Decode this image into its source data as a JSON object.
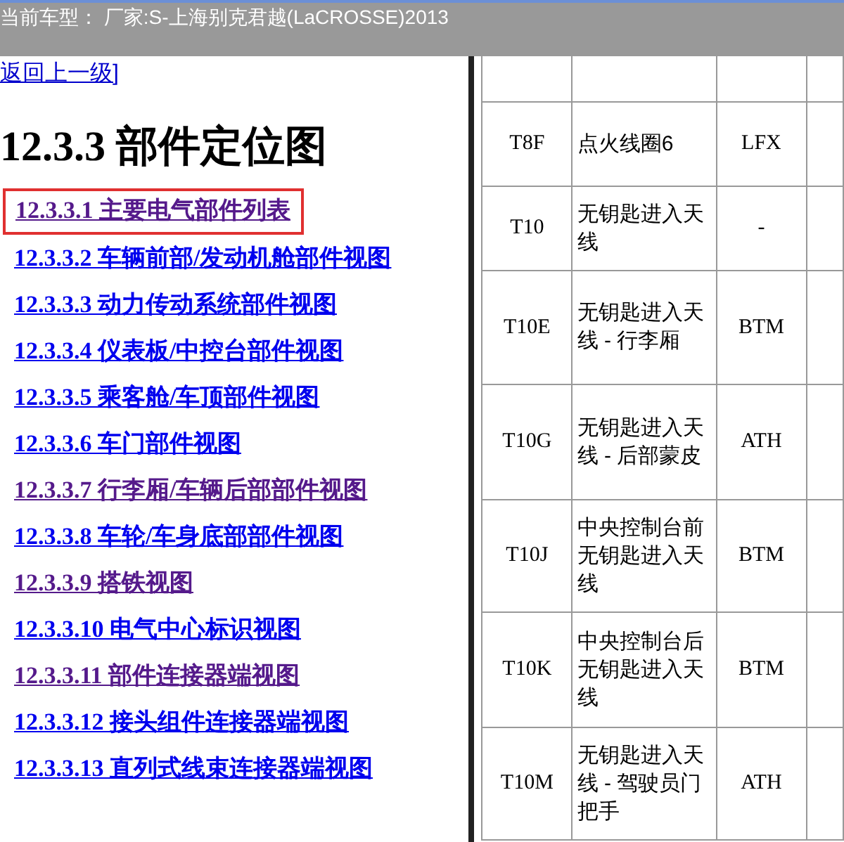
{
  "header": {
    "title": "当前车型： 厂家:S-上海别克君越(LaCROSSE)2013"
  },
  "back_link": "返回上一级]",
  "heading": "12.3.3 部件定位图",
  "links": [
    {
      "label": "12.3.3.1 主要电气部件列表",
      "visited": true,
      "selected": true
    },
    {
      "label": "12.3.3.2 车辆前部/发动机舱部件视图",
      "visited": false,
      "selected": false
    },
    {
      "label": "12.3.3.3 动力传动系统部件视图",
      "visited": false,
      "selected": false
    },
    {
      "label": "12.3.3.4 仪表板/中控台部件视图",
      "visited": false,
      "selected": false
    },
    {
      "label": "12.3.3.5 乘客舱/车顶部件视图",
      "visited": false,
      "selected": false
    },
    {
      "label": "12.3.3.6 车门部件视图",
      "visited": false,
      "selected": false
    },
    {
      "label": "12.3.3.7 行李厢/车辆后部部件视图",
      "visited": true,
      "selected": false
    },
    {
      "label": "12.3.3.8 车轮/车身底部部件视图",
      "visited": false,
      "selected": false
    },
    {
      "label": "12.3.3.9 搭铁视图",
      "visited": true,
      "selected": false
    },
    {
      "label": "12.3.3.10 电气中心标识视图",
      "visited": false,
      "selected": false
    },
    {
      "label": "12.3.3.11 部件连接器端视图",
      "visited": true,
      "selected": false
    },
    {
      "label": "12.3.3.12 接头组件连接器端视图",
      "visited": false,
      "selected": false
    },
    {
      "label": "12.3.3.13 直列式线束连接器端视图",
      "visited": false,
      "selected": false
    }
  ],
  "table": {
    "rows": [
      {
        "column_1": "T8F",
        "column_2": "点火线圈6",
        "column_3": "LFX"
      },
      {
        "column_1": "T10",
        "column_2": "无钥匙进入天线",
        "column_3": "-"
      },
      {
        "column_1": "T10E",
        "column_2": "无钥匙进入天线 - 行李厢",
        "column_3": "BTM"
      },
      {
        "column_1": "T10G",
        "column_2": "无钥匙进入天线 - 后部蒙皮",
        "column_3": "ATH"
      },
      {
        "column_1": "T10J",
        "column_2": "中央控制台前无钥匙进入天线",
        "column_3": "BTM"
      },
      {
        "column_1": "T10K",
        "column_2": "中央控制台后无钥匙进入天线",
        "column_3": "BTM"
      },
      {
        "column_1": "T10M",
        "column_2": "无钥匙进入天线 - 驾驶员门把手",
        "column_3": "ATH"
      }
    ]
  }
}
